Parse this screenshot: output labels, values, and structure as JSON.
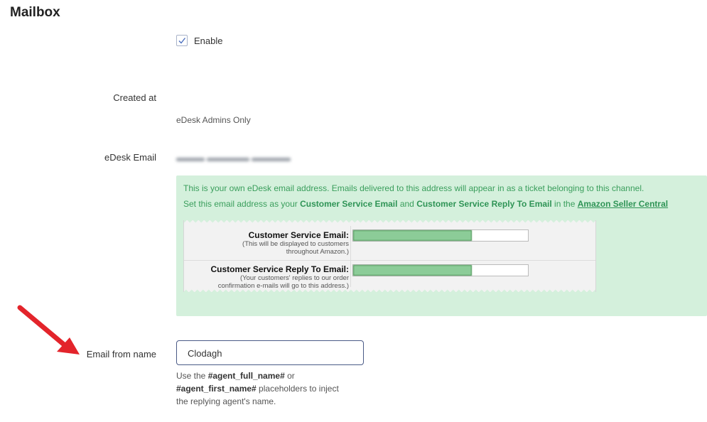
{
  "page": {
    "title": "Mailbox"
  },
  "enable": {
    "label": "Enable",
    "checked": true
  },
  "created_at": {
    "label": "Created at",
    "value": "eDesk Admins Only"
  },
  "edesk_email": {
    "label": "eDesk Email",
    "value": "ch19662-domikgjgl@roxell.co"
  },
  "info": {
    "line1": "This is your own eDesk email address. Emails delivered to this address will appear in as a ticket belonging to this channel.",
    "line2_prefix": "Set this email address as your ",
    "line2_bold1": "Customer Service Email",
    "line2_and": " and ",
    "line2_bold2": "Customer Service Reply To Email",
    "line2_in": " in the ",
    "line2_link": "Amazon Seller Central",
    "embedded": {
      "cs_email_label": "Customer Service Email:",
      "cs_email_note_1": "(This will be displayed to customers",
      "cs_email_note_2": "throughout Amazon.)",
      "reply_label": "Customer Service Reply To Email:",
      "reply_note_1": "(Your customers' replies to our order",
      "reply_note_2": "confirmation e-mails will go to this address.)"
    }
  },
  "from_name": {
    "label": "Email from name",
    "value": "Clodagh",
    "help_prefix": "Use the ",
    "help_token1": "#agent_full_name#",
    "help_or": " or",
    "help_token2": "#agent_first_name#",
    "help_suffix_1": " placeholders to inject",
    "help_suffix_2": "the replying agent's name."
  },
  "colors": {
    "info_bg": "#d4f0dc",
    "info_text": "#3a9e5c",
    "input_border": "#4a5a86",
    "arrow": "#e3242b"
  }
}
